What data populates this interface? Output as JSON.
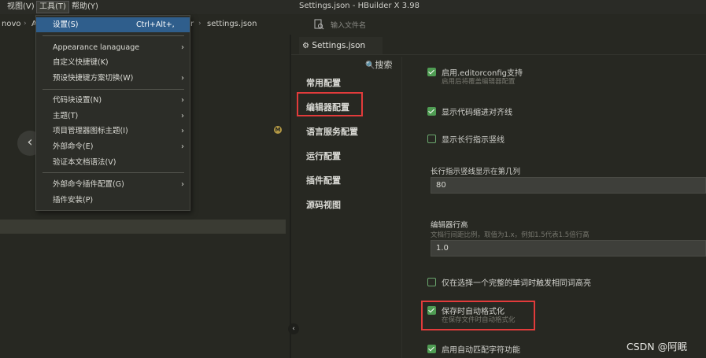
{
  "window": {
    "title": "Settings.json - HBuilder X 3.98"
  },
  "menubar": {
    "items": [
      "视图(V)",
      "工具(T)",
      "帮助(Y)"
    ]
  },
  "breadcrumb": {
    "items": [
      "novo",
      "A",
      "r",
      "settings.json"
    ]
  },
  "file_filter": {
    "placeholder": "输入文件名"
  },
  "dropdown": {
    "items": [
      {
        "label": "设置(S)",
        "shortcut": "Ctrl+Alt+,",
        "has_submenu": false
      },
      {
        "label": "Appearance lanaguage",
        "has_submenu": true
      },
      {
        "label": "自定义快捷键(K)",
        "has_submenu": false
      },
      {
        "label": "预设快捷键方案切换(W)",
        "has_submenu": true
      },
      {
        "label": "代码块设置(N)",
        "has_submenu": true
      },
      {
        "label": "主题(T)",
        "has_submenu": true
      },
      {
        "label": "项目管理器图标主题(I)",
        "has_submenu": true
      },
      {
        "label": "外部命令(E)",
        "has_submenu": true
      },
      {
        "label": "验证本文档语法(V)",
        "has_submenu": false
      },
      {
        "label": "外部命令插件配置(G)",
        "has_submenu": true
      },
      {
        "label": "插件安装(P)",
        "has_submenu": false
      }
    ]
  },
  "settings": {
    "tab_title": "Settings.json",
    "search_label": "搜索",
    "sidebar": [
      "常用配置",
      "编辑器配置",
      "语言服务配置",
      "运行配置",
      "插件配置",
      "源码视图"
    ],
    "options": [
      {
        "label": "启用.editorconfig支持",
        "sub": "启用后将覆盖编辑器配置",
        "checked": true
      },
      {
        "label": "显示代码缩进对齐线",
        "sub": "",
        "checked": true
      },
      {
        "label": "显示长行指示竖线",
        "sub": "",
        "checked": false
      }
    ],
    "long_line": {
      "label": "长行指示竖线显示在第几列",
      "value": "80"
    },
    "line_height": {
      "label": "编辑器行高",
      "sub": "文档行间距比例，取值为1.x，例如1.5代表1.5倍行高",
      "value": "1.0"
    },
    "options2": [
      {
        "label": "仅在选择一个完整的单词时触发相同词高亮",
        "sub": "",
        "checked": false
      },
      {
        "label": "保存时自动格式化",
        "sub": "在保存文件时自动格式化",
        "checked": true
      },
      {
        "label": "启用自动匹配字符功能",
        "sub": "",
        "checked": true
      }
    ]
  },
  "badge_letter": "M",
  "watermark": "CSDN @阿眠",
  "colors": {
    "accent_red": "#e23b3b",
    "selected_blue": "#2f5e8c",
    "check_green": "#4f9c53"
  }
}
